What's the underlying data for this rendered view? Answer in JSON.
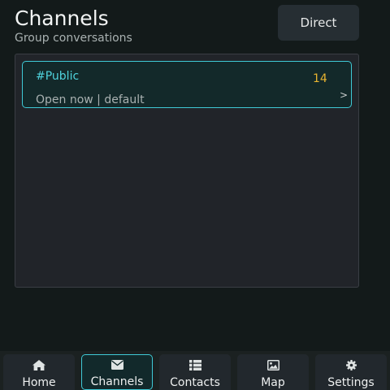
{
  "header": {
    "title": "Channels",
    "subtitle": "Group conversations",
    "direct_label": "Direct"
  },
  "channels": [
    {
      "name": "#Public",
      "count": "14",
      "detail": "Open now | default",
      "chevron": ">"
    }
  ],
  "tabs": [
    {
      "label": "Home",
      "icon": "home-icon"
    },
    {
      "label": "Channels",
      "icon": "envelope-icon",
      "active": true
    },
    {
      "label": "Contacts",
      "icon": "list-icon"
    },
    {
      "label": "Map",
      "icon": "image-icon"
    },
    {
      "label": "Settings",
      "icon": "gear-icon"
    }
  ],
  "colors": {
    "background": "#131a1a",
    "accent": "#3fcad6",
    "count": "#e8b430",
    "panel": "#212429"
  }
}
